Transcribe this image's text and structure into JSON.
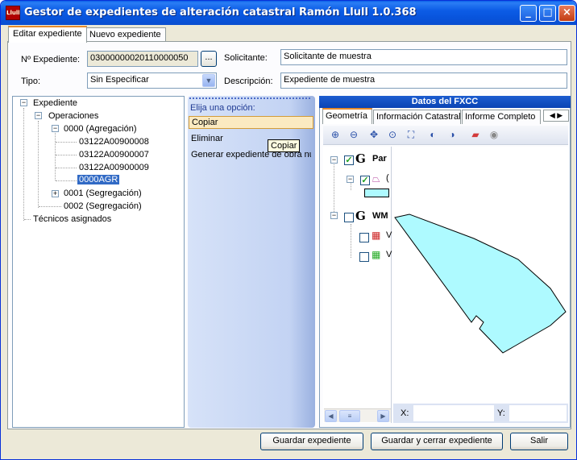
{
  "window": {
    "title": "Gestor de expedientes de alteración catastral Ramón Llull 1.0.368",
    "icon_text": "Llull"
  },
  "tabs": [
    {
      "label": "Editar expediente"
    },
    {
      "label": "Nuevo expediente"
    }
  ],
  "form": {
    "expediente_label": "Nº Expediente:",
    "expediente_value": "03000000020110000050",
    "browse_label": "...",
    "tipo_label": "Tipo:",
    "tipo_value": "Sin Especificar",
    "solicitante_label": "Solicitante:",
    "solicitante_value": "Solicitante de muestra",
    "descripcion_label": "Descripción:",
    "descripcion_value": "Expediente de muestra"
  },
  "tree": {
    "root": "Expediente",
    "operaciones": "Operaciones",
    "op0": "0000 (Agregación)",
    "op0_children": [
      "03122A00900008",
      "03122A00900007",
      "03122A00900009",
      "0000AGR"
    ],
    "op1": "0001 (Segregación)",
    "op2": "0002 (Segregación)",
    "tecnicos": "Técnicos asignados"
  },
  "actions": {
    "header": "Elija una opción:",
    "items": [
      "Copiar",
      "Eliminar",
      "Generar expediente de obra nueva"
    ],
    "tooltip": "Copiar"
  },
  "fxcc": {
    "header": "Datos del FXCC",
    "tabs": [
      "Geometría",
      "Información Catastral",
      "Informe Completo"
    ],
    "layers": [
      {
        "glyph": "G",
        "label": "Par",
        "checked": true
      },
      {
        "glyph": "G",
        "label": "WM",
        "checked": false
      }
    ],
    "sublayer_label": "(",
    "wms_items": [
      "V",
      "V"
    ],
    "coord_x_label": "X:",
    "coord_y_label": "Y:",
    "parcel_color": "#aefaff"
  },
  "buttons": {
    "guardar": "Guardar expediente",
    "guardar_cerrar": "Guardar y cerrar expediente",
    "salir": "Salir"
  }
}
